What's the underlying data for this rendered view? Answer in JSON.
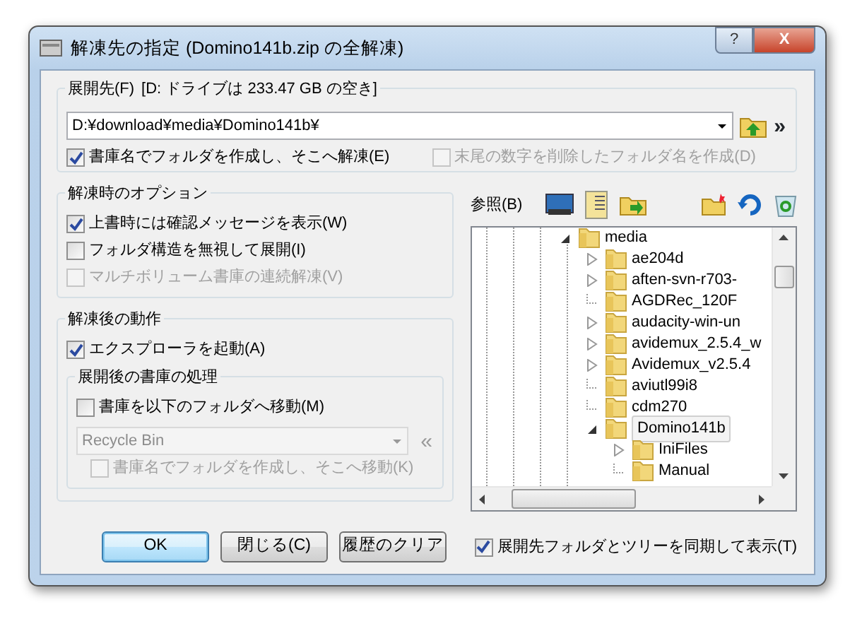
{
  "window": {
    "title": "解凍先の指定 (Domino141b.zip の全解凍)",
    "help_button": "?",
    "close_button": "X"
  },
  "destination": {
    "label": "展開先(F)",
    "free_space": "[D: ドライブは 233.47 GB の空き]",
    "path": "D:¥download¥media¥Domino141b¥",
    "more_button": "»",
    "options": [
      {
        "label": "書庫名でフォルダを作成し、そこへ解凍(E)",
        "checked": true,
        "disabled": false
      },
      {
        "label": "末尾の数字を削除したフォルダ名を作成(D)",
        "checked": false,
        "disabled": true
      }
    ]
  },
  "extract_options": {
    "label": "解凍時のオプション",
    "options": [
      {
        "label": "上書時には確認メッセージを表示(W)",
        "checked": true,
        "disabled": false
      },
      {
        "label": "フォルダ構造を無視して展開(I)",
        "checked": false,
        "disabled": false
      },
      {
        "label": "マルチボリューム書庫の連続解凍(V)",
        "checked": false,
        "disabled": true
      }
    ]
  },
  "after_extract": {
    "label": "解凍後の動作",
    "launch_explorer": {
      "label": "エクスプローラを起動(A)",
      "checked": true,
      "disabled": false
    },
    "archive_handling": {
      "label": "展開後の書庫の処理",
      "move": {
        "label": "書庫を以下のフォルダへ移動(M)",
        "checked": false,
        "disabled": false
      },
      "folder": "Recycle Bin",
      "folder_disabled": true,
      "history_button": "«",
      "subfolder": {
        "label": "書庫名でフォルダを作成し、そこへ移動(K)",
        "checked": false,
        "disabled": true
      }
    }
  },
  "browse": {
    "label": "参照(B)",
    "tree": [
      {
        "label": "media",
        "kind": "expanded",
        "selected": false,
        "children": [
          {
            "label": "ae204d",
            "kind": "collapsed",
            "selected": false
          },
          {
            "label": "aften-svn-r703-",
            "kind": "collapsed",
            "selected": false
          },
          {
            "label": "AGDRec_120F",
            "kind": "leaf",
            "selected": false
          },
          {
            "label": "audacity-win-un",
            "kind": "collapsed",
            "selected": false
          },
          {
            "label": "avidemux_2.5.4_w",
            "kind": "collapsed",
            "selected": false
          },
          {
            "label": "Avidemux_v2.5.4",
            "kind": "collapsed",
            "selected": false
          },
          {
            "label": "aviutl99i8",
            "kind": "leaf",
            "selected": false
          },
          {
            "label": "cdm270",
            "kind": "leaf",
            "selected": false
          },
          {
            "label": "Domino141b",
            "kind": "expanded",
            "selected": true,
            "children": [
              {
                "label": "IniFiles",
                "kind": "collapsed",
                "selected": false
              },
              {
                "label": "Manual",
                "kind": "leaf",
                "selected": false
              }
            ]
          }
        ]
      }
    ]
  },
  "buttons": [
    {
      "label": "OK",
      "default": true
    },
    {
      "label": "閉じる(C)",
      "default": false
    },
    {
      "label": "履歴のクリア",
      "default": false
    }
  ],
  "sync_tree": {
    "label": "展開先フォルダとツリーを同期して表示(T)",
    "checked": true,
    "disabled": false
  }
}
